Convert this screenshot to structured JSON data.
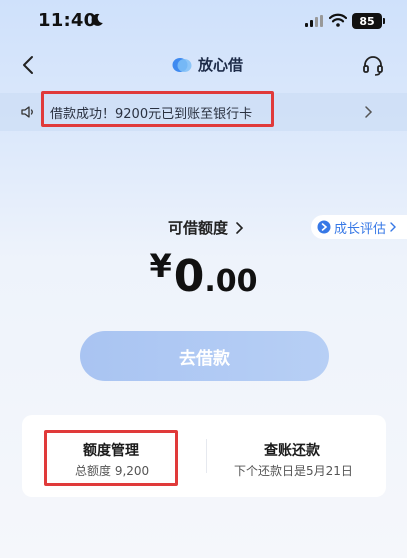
{
  "status_bar": {
    "time": "11:40",
    "battery": "85"
  },
  "nav": {
    "title": "放心借"
  },
  "notice": {
    "text": "借款成功！9200元已到账至银行卡"
  },
  "credit": {
    "label": "可借额度",
    "amount_symbol": "¥",
    "amount_int": "0",
    "amount_dec": ".00",
    "growth_label": "成长评估"
  },
  "borrow_button": {
    "label": "去借款"
  },
  "card": {
    "limit_title": "额度管理",
    "limit_sub": "总额度 9,200",
    "bill_title": "查账还款",
    "bill_sub": "下个还款日是5月21日"
  },
  "colors": {
    "accent": "#3778e6",
    "highlight": "#e03a3a",
    "button": "#b0c9f3"
  }
}
